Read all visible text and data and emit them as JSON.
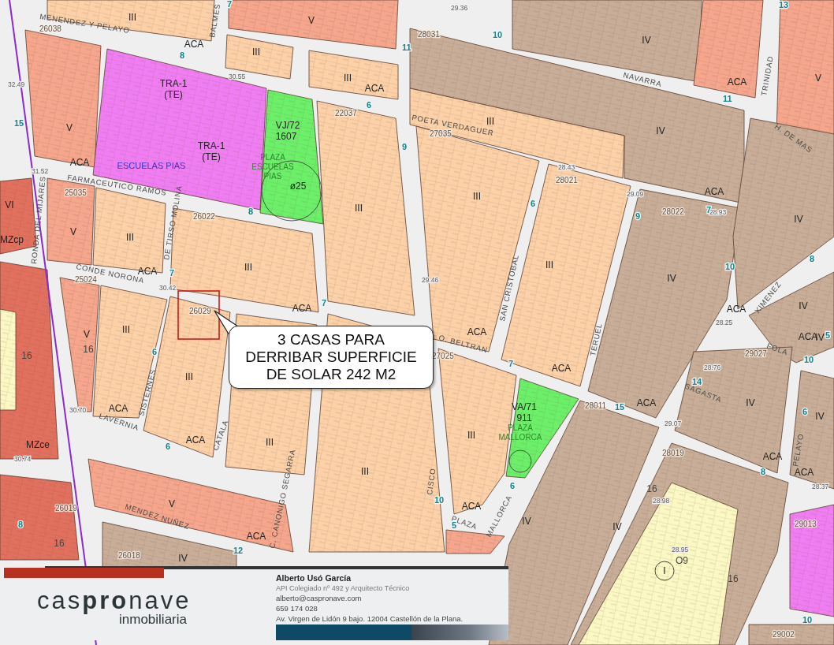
{
  "map": {
    "zones": [
      {
        "text": "III",
        "kind": "zone"
      },
      {
        "text": "V",
        "kind": "zone"
      },
      {
        "text": "III",
        "kind": "zone"
      },
      {
        "text": "ACA",
        "kind": "zone"
      },
      {
        "text": "III",
        "kind": "zone"
      },
      {
        "text": "ACA",
        "kind": "zone"
      },
      {
        "text": "TRA-1",
        "kind": "zone"
      },
      {
        "text": "(TE)",
        "kind": "zone"
      },
      {
        "text": "TRA-1",
        "kind": "zone"
      },
      {
        "text": "(TE)",
        "kind": "zone"
      },
      {
        "text": "ESCUELAS PIAS",
        "kind": "name"
      },
      {
        "text": "V",
        "kind": "zone"
      },
      {
        "text": "ACA",
        "kind": "zone"
      },
      {
        "text": "VJ/72",
        "kind": "zone"
      },
      {
        "text": "1607",
        "kind": "zone"
      },
      {
        "text": "PLAZA",
        "kind": "plaza"
      },
      {
        "text": "ESCUELAS",
        "kind": "plaza"
      },
      {
        "text": "PIAS",
        "kind": "plaza"
      },
      {
        "text": "IV",
        "kind": "zone"
      },
      {
        "text": "ACA",
        "kind": "zone"
      },
      {
        "text": "V",
        "kind": "zone"
      },
      {
        "text": "III",
        "kind": "zone"
      },
      {
        "text": "IV",
        "kind": "zone"
      },
      {
        "text": "ACA",
        "kind": "zone"
      },
      {
        "text": "III",
        "kind": "zone"
      },
      {
        "text": "III",
        "kind": "zone"
      },
      {
        "text": "IV",
        "kind": "zone"
      },
      {
        "text": "VI",
        "kind": "zone"
      },
      {
        "text": "MZcp",
        "kind": "zone"
      },
      {
        "text": "V",
        "kind": "zone"
      },
      {
        "text": "III",
        "kind": "zone"
      },
      {
        "text": "III",
        "kind": "zone"
      },
      {
        "text": "ACA",
        "kind": "zone"
      },
      {
        "text": "ACA",
        "kind": "zone"
      },
      {
        "text": "III",
        "kind": "zone"
      },
      {
        "text": "IV",
        "kind": "zone"
      },
      {
        "text": "ACA",
        "kind": "zone"
      },
      {
        "text": "ACA",
        "kind": "zone"
      },
      {
        "text": "ACA",
        "kind": "zone"
      },
      {
        "text": "ACA",
        "kind": "zone"
      },
      {
        "text": "IV",
        "kind": "zone"
      },
      {
        "text": "ACA",
        "kind": "zone"
      },
      {
        "text": "IV",
        "kind": "zone"
      },
      {
        "text": "IV",
        "kind": "zone"
      },
      {
        "text": "ACA",
        "kind": "zone"
      },
      {
        "text": "ACA",
        "kind": "zone"
      },
      {
        "text": "V",
        "kind": "zone"
      },
      {
        "text": "III",
        "kind": "zone"
      },
      {
        "text": "16",
        "kind": "measure"
      },
      {
        "text": "16",
        "kind": "measure"
      },
      {
        "text": "III",
        "kind": "zone"
      },
      {
        "text": "ACA",
        "kind": "zone"
      },
      {
        "text": "ACA",
        "kind": "zone"
      },
      {
        "text": "MZce",
        "kind": "zone"
      },
      {
        "text": "III",
        "kind": "zone"
      },
      {
        "text": "III",
        "kind": "zone"
      },
      {
        "text": "VA/71",
        "kind": "zone"
      },
      {
        "text": "911",
        "kind": "zone"
      },
      {
        "text": "PLAZA",
        "kind": "plaza"
      },
      {
        "text": "MALLORCA",
        "kind": "plaza"
      },
      {
        "text": "ACA",
        "kind": "zone"
      },
      {
        "text": "III",
        "kind": "zone"
      },
      {
        "text": "IV",
        "kind": "zone"
      },
      {
        "text": "IV",
        "kind": "zone"
      },
      {
        "text": "V",
        "kind": "zone"
      },
      {
        "text": "ACA",
        "kind": "zone"
      },
      {
        "text": "16",
        "kind": "measure"
      },
      {
        "text": "16",
        "kind": "measure"
      },
      {
        "text": "I",
        "kind": "zone"
      },
      {
        "text": "O9",
        "kind": "measure"
      },
      {
        "text": "16",
        "kind": "measure"
      },
      {
        "text": "IV",
        "kind": "zone"
      },
      {
        "text": "ø25",
        "kind": "zone"
      },
      {
        "text": "IV",
        "kind": "zone"
      }
    ],
    "parcels": [
      "26038",
      "25035",
      "26022",
      "25024",
      "26029",
      "22037",
      "27035",
      "28031",
      "28021",
      "28022",
      "29027",
      "27025",
      "28011",
      "28019",
      "26019",
      "26018",
      "29013",
      "29002"
    ],
    "streets": [
      "MENENDEZ Y PELAYO",
      "BALMES",
      "NAVARRA",
      "TRINIDAD",
      "POETA VERDAGUER",
      "FARMACEUTICO RAMOS",
      "RONDA DEL MIJARES",
      "DE TIRSO MOLINA",
      "CONDE NORONA",
      "SISTERNES",
      "LAVERNIA",
      "CATALA",
      "C. CANONIGO SEGARRA",
      "MENDEZ NUÑEZ",
      "O. BELTRAN",
      "SAN CRISTOBAL",
      "TERUEL",
      "FOLA",
      "XIMENEZ",
      "SAGASTA",
      "PELAYO",
      "MALLORCA",
      "PLAZA",
      "CISCO",
      "H. DE MAS"
    ],
    "widths": [
      "7",
      "8",
      "15",
      "11",
      "10",
      "6",
      "9",
      "8",
      "7",
      "7",
      "6",
      "6",
      "7",
      "6",
      "9",
      "7",
      "11",
      "13",
      "10",
      "8",
      "5",
      "10",
      "14",
      "6",
      "15",
      "6",
      "10",
      "5",
      "12",
      "8",
      "8",
      "10"
    ],
    "elevations": [
      "29.36",
      "30.55",
      "32.49",
      "31.52",
      "30.42",
      "28.43",
      "29.09",
      "28.93",
      "28.76",
      "29.07",
      "28.98",
      "28.95",
      "30.74",
      "30.70",
      "28.25",
      "29.46",
      "28.37"
    ],
    "callout": {
      "lines": [
        "3 CASAS PARA",
        "DERRIBAR SUPERFICIE",
        "DE SOLAR 242 M2"
      ]
    }
  },
  "banner": {
    "logo": "cas**pro**nave",
    "tagline": "inmobiliaria",
    "contact": {
      "name": "Alberto Usó García",
      "title": "API Colegiado nº 492 y Arquitecto Técnico",
      "email": "alberto@caspronave.com",
      "phone": "659 174 028",
      "address": "Av. Virgen de Lidón 9 bajo. 12004 Castellón de la Plana."
    }
  }
}
